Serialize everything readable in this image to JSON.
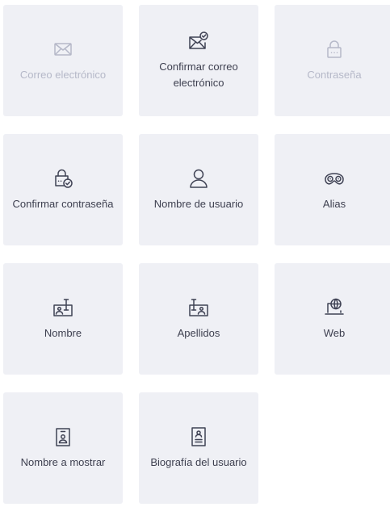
{
  "fields": [
    {
      "label": "Correo electrónico",
      "icon": "envelope-icon",
      "disabled": true
    },
    {
      "label": "Confirmar correo electrónico",
      "icon": "envelope-check-icon",
      "disabled": false
    },
    {
      "label": "Contraseña",
      "icon": "lock-icon",
      "disabled": true
    },
    {
      "label": "Confirmar contraseña",
      "icon": "lock-check-icon",
      "disabled": false
    },
    {
      "label": "Nombre de usuario",
      "icon": "user-icon",
      "disabled": false
    },
    {
      "label": "Alias",
      "icon": "mask-icon",
      "disabled": false
    },
    {
      "label": "Nombre",
      "icon": "id-card-icon",
      "disabled": false
    },
    {
      "label": "Apellidos",
      "icon": "id-card-alt-icon",
      "disabled": false
    },
    {
      "label": "Web",
      "icon": "globe-laptop-icon",
      "disabled": false
    },
    {
      "label": "Nombre a mostrar",
      "icon": "badge-icon",
      "disabled": false
    },
    {
      "label": "Biografía del usuario",
      "icon": "document-user-icon",
      "disabled": false
    }
  ]
}
